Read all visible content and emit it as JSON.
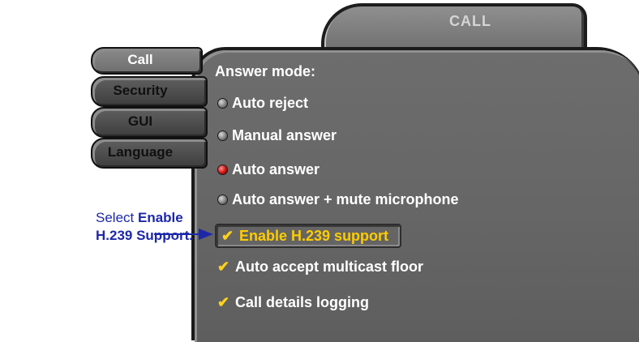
{
  "window": {
    "title": "CALL"
  },
  "nav": {
    "items": [
      {
        "label": "Call",
        "active": true
      },
      {
        "label": "Security",
        "active": false
      },
      {
        "label": "GUI",
        "active": false
      },
      {
        "label": "Language",
        "active": false
      }
    ]
  },
  "answer_mode": {
    "title": "Answer mode:",
    "options": [
      {
        "label": "Auto reject",
        "selected": false
      },
      {
        "label": "Manual answer",
        "selected": false
      },
      {
        "label": "Auto answer",
        "selected": true
      },
      {
        "label": "Auto answer + mute microphone",
        "selected": false
      }
    ]
  },
  "checkboxes": [
    {
      "label": "Enable H.239 support",
      "checked": true,
      "highlighted": true
    },
    {
      "label": "Auto accept multicast floor",
      "checked": true
    },
    {
      "label": "Call details logging",
      "checked": true
    }
  ],
  "callout": {
    "prefix": "Select ",
    "bold1": "Enable",
    "bold2": "H.239 Support."
  },
  "glyphs": {
    "check": "✔"
  },
  "colors": {
    "accent_yellow": "#ffcc00",
    "callout_blue": "#1d28a8",
    "radio_selected": "#d01010"
  }
}
